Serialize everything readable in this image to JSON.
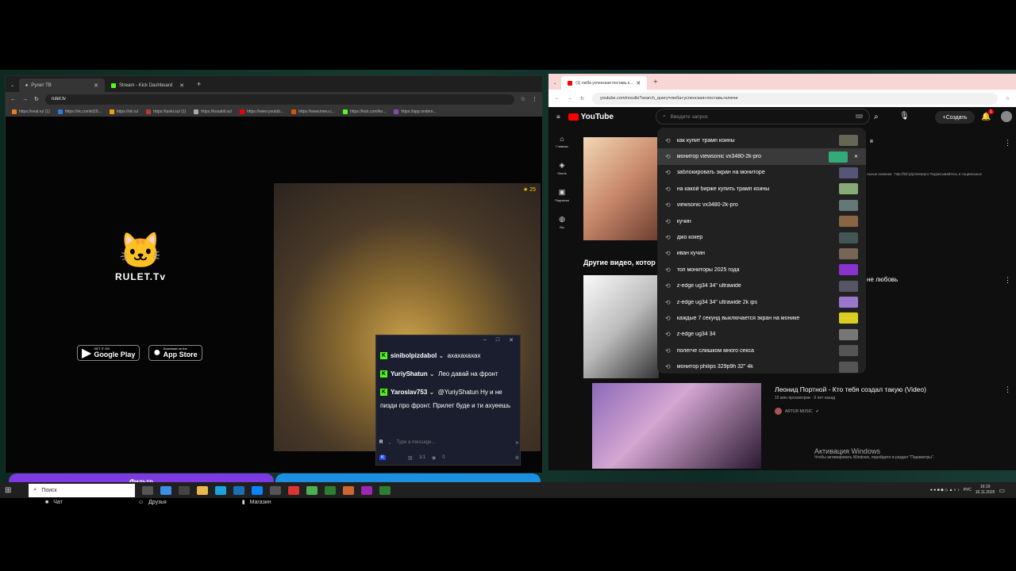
{
  "left": {
    "tabs": [
      {
        "label": "Рулет ТВ",
        "active": true
      },
      {
        "label": "Stream - Kick Dashboard",
        "active": false
      }
    ],
    "url": "rulet.tv",
    "bookmarks": [
      "https://oval.ru/ (1)",
      "https://vk.com/id19...",
      "https://ok.ru/",
      "https://tanki.su/ (1)",
      "https://kosabli.su/",
      "https://www.youtub...",
      "https://www.imeu.c...",
      "https://kick.com/ko...",
      "https://app.ondem..."
    ],
    "logo_text": "RULET.Tv",
    "stores": [
      {
        "small": "GET IT ON",
        "big": "Google Play"
      },
      {
        "small": "Download on the",
        "big": "App Store"
      }
    ],
    "video_badge": "25",
    "purple_button": "Фильтр",
    "nav": [
      "Чат",
      "Друзья",
      "Магазин"
    ]
  },
  "chat": {
    "messages": [
      {
        "user": "sinibolpizdabol",
        "text": "ахахахахах"
      },
      {
        "user": "YuriyShatun",
        "text": "Лео давай на фронт"
      },
      {
        "user": "Yaroslav753",
        "text": "@YuriyShatun Ну и не пизди про фронт. Прилет буде и ти ахуеешь"
      }
    ],
    "placeholder": "Type a message...",
    "footer_count1": "1/1",
    "footer_count2": "0"
  },
  "right": {
    "tab_label": "(1) люба успенская поставь к...",
    "url": "youtube.com/results?search_query=люба+успенская+поставь+ключи",
    "brand": "YouTube",
    "search_placeholder": "Введите запрос",
    "create_label": "Создать",
    "notif_count": "1",
    "sidebar": [
      "Главная",
      "Shorts",
      "Подписки",
      "Вы"
    ],
    "suggestions": [
      "как купит трамп коины",
      "монитор viewsonic vx3480-2k-pro",
      "заблокировать экран на мониторе",
      "на какой бирже купить трамп коины",
      "viewsonic vx3480-2k-pro",
      "кучин",
      "джо кокер",
      "иван кучин",
      "топ мониторы 2025 года",
      "z-edge ug34 34\" ultrawide",
      "z-edge ug34 34\" ultrawide 2k ips",
      "каждые 7 секунд выключается экран на монике",
      "z-edge ug34 34",
      "полегче слишком много секса",
      "монитор philips 329p9h 32\" 4k"
    ],
    "right_partial": "я",
    "desc": "льные новинки · http://bit.ly/joinstarpro Подписывайтесь и социальных",
    "other_videos": "Другие видео, котор",
    "video_side": "не любовь",
    "video_title": "Леонид Портной - Кто тебя создал такую (Video)",
    "video_channel": "ARTUR MUSIC",
    "views_line": "15 млн просмотров · 9 лет назад",
    "activation_title": "Активация Windows",
    "activation_sub": "Чтобы активировать Windows, перейдите в раздел \"Параметры\"."
  },
  "taskbar": {
    "search_placeholder": "Поиск",
    "lang": "РУС",
    "time": "16:19",
    "date": "16.11.2025"
  }
}
